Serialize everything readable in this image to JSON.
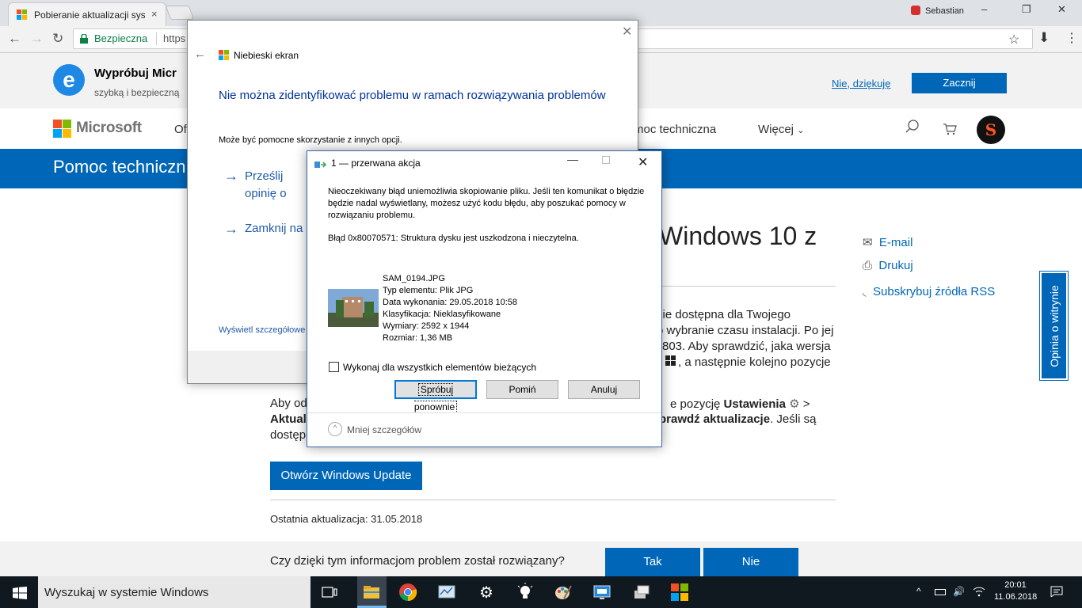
{
  "browser": {
    "tab_title": "Pobieranie aktualizacji sys",
    "tab_close": "×",
    "profile_name": "Sebastian",
    "secure_label": "Bezpieczna",
    "url": "https",
    "win_min": "–",
    "win_max": "❐",
    "win_close": "✕"
  },
  "promo": {
    "title": "Wypróbuj Micr",
    "subtitle": "szybką i bezpieczną",
    "no_thanks": "Nie, dziękuję",
    "start": "Zacznij"
  },
  "ms_header": {
    "brand": "Microsoft",
    "nav_office": "Of",
    "nav_support": "moc techniczna",
    "nav_more": "Więcej",
    "avatar_letter": "S"
  },
  "band": {
    "title": "Pomoc techniczn"
  },
  "article": {
    "heading": "Windows 10 z",
    "p1": [
      "zie dostępna dla Twojego",
      "o wybranie czasu instalacji. Po jej",
      "803. Aby sprawdzić, jaka wersja",
      ", a następnie kolejno pozycje"
    ],
    "p2_a": "Aby od",
    "p2_a_right": "e pozycję",
    "p2_settings": "Ustawienia",
    "p2_gt": ">",
    "p2_b": "Aktual",
    "p2_b_right": "prawdź aktualizacje",
    "p2_b_tail": ". Jeśli są",
    "p2_c": "dostęp",
    "open_wu": "Otwórz Windows Update",
    "last_update": "Ostatnia aktualizacja: 31.05.2018"
  },
  "side": {
    "email": "E-mail",
    "print": "Drukuj",
    "rss": "Subskrybuj źródła RSS",
    "feedback_tab": "Opinia o witrynie"
  },
  "feedback": {
    "question": "Czy dzięki tym informacjom problem został rozwiązany?",
    "yes": "Tak",
    "no": "Nie"
  },
  "troubleshooter": {
    "back": "←",
    "close": "✕",
    "app": "Niebieski ekran",
    "heading": "Nie można zidentyfikować problemu w ramach rozwiązywania problemów",
    "sub": "Może być pomocne skorzystanie z innych opcji.",
    "option1": "Prześlij opinię o problemów",
    "option2": "Zamknij na",
    "details": "Wyświetl szczegółowe",
    "arrow": "→"
  },
  "dialog": {
    "title": "1 — przerwana akcja",
    "min": "—",
    "close": "✕",
    "message": "Nieoczekiwany błąd uniemożliwia skopiowanie pliku. Jeśli ten komunikat o błędzie będzie nadal wyświetlany, możesz użyć kodu błędu, aby poszukać pomocy w rozwiązaniu problemu.",
    "error": "Błąd 0x80070571: Struktura dysku jest uszkodzona i nieczytelna.",
    "file_name": "SAM_0194.JPG",
    "file_type": "Typ elementu: Plik JPG",
    "file_date": "Data wykonania: 29.05.2018 10:58",
    "file_class": "Klasyfikacja: Nieklasyfikowane",
    "file_dims": "Wymiary: 2592 x 1944",
    "file_size": "Rozmiar: 1,36 MB",
    "apply_all": "Wykonaj dla wszystkich elementów bieżących",
    "retry": "Spróbuj ponownie",
    "skip": "Pomiń",
    "cancel": "Anuluj",
    "fewer_details": "Mniej szczegółów",
    "chevron": "^"
  },
  "taskbar": {
    "search_placeholder": "Wyszukaj w systemie Windows",
    "time": "20:01",
    "date": "11.06.2018",
    "tray_chevron": "^",
    "tray_volume": "🔊"
  },
  "colors": {
    "accent": "#0067b8",
    "taskbar": "#101820",
    "dialog_border": "#3a66b0"
  }
}
